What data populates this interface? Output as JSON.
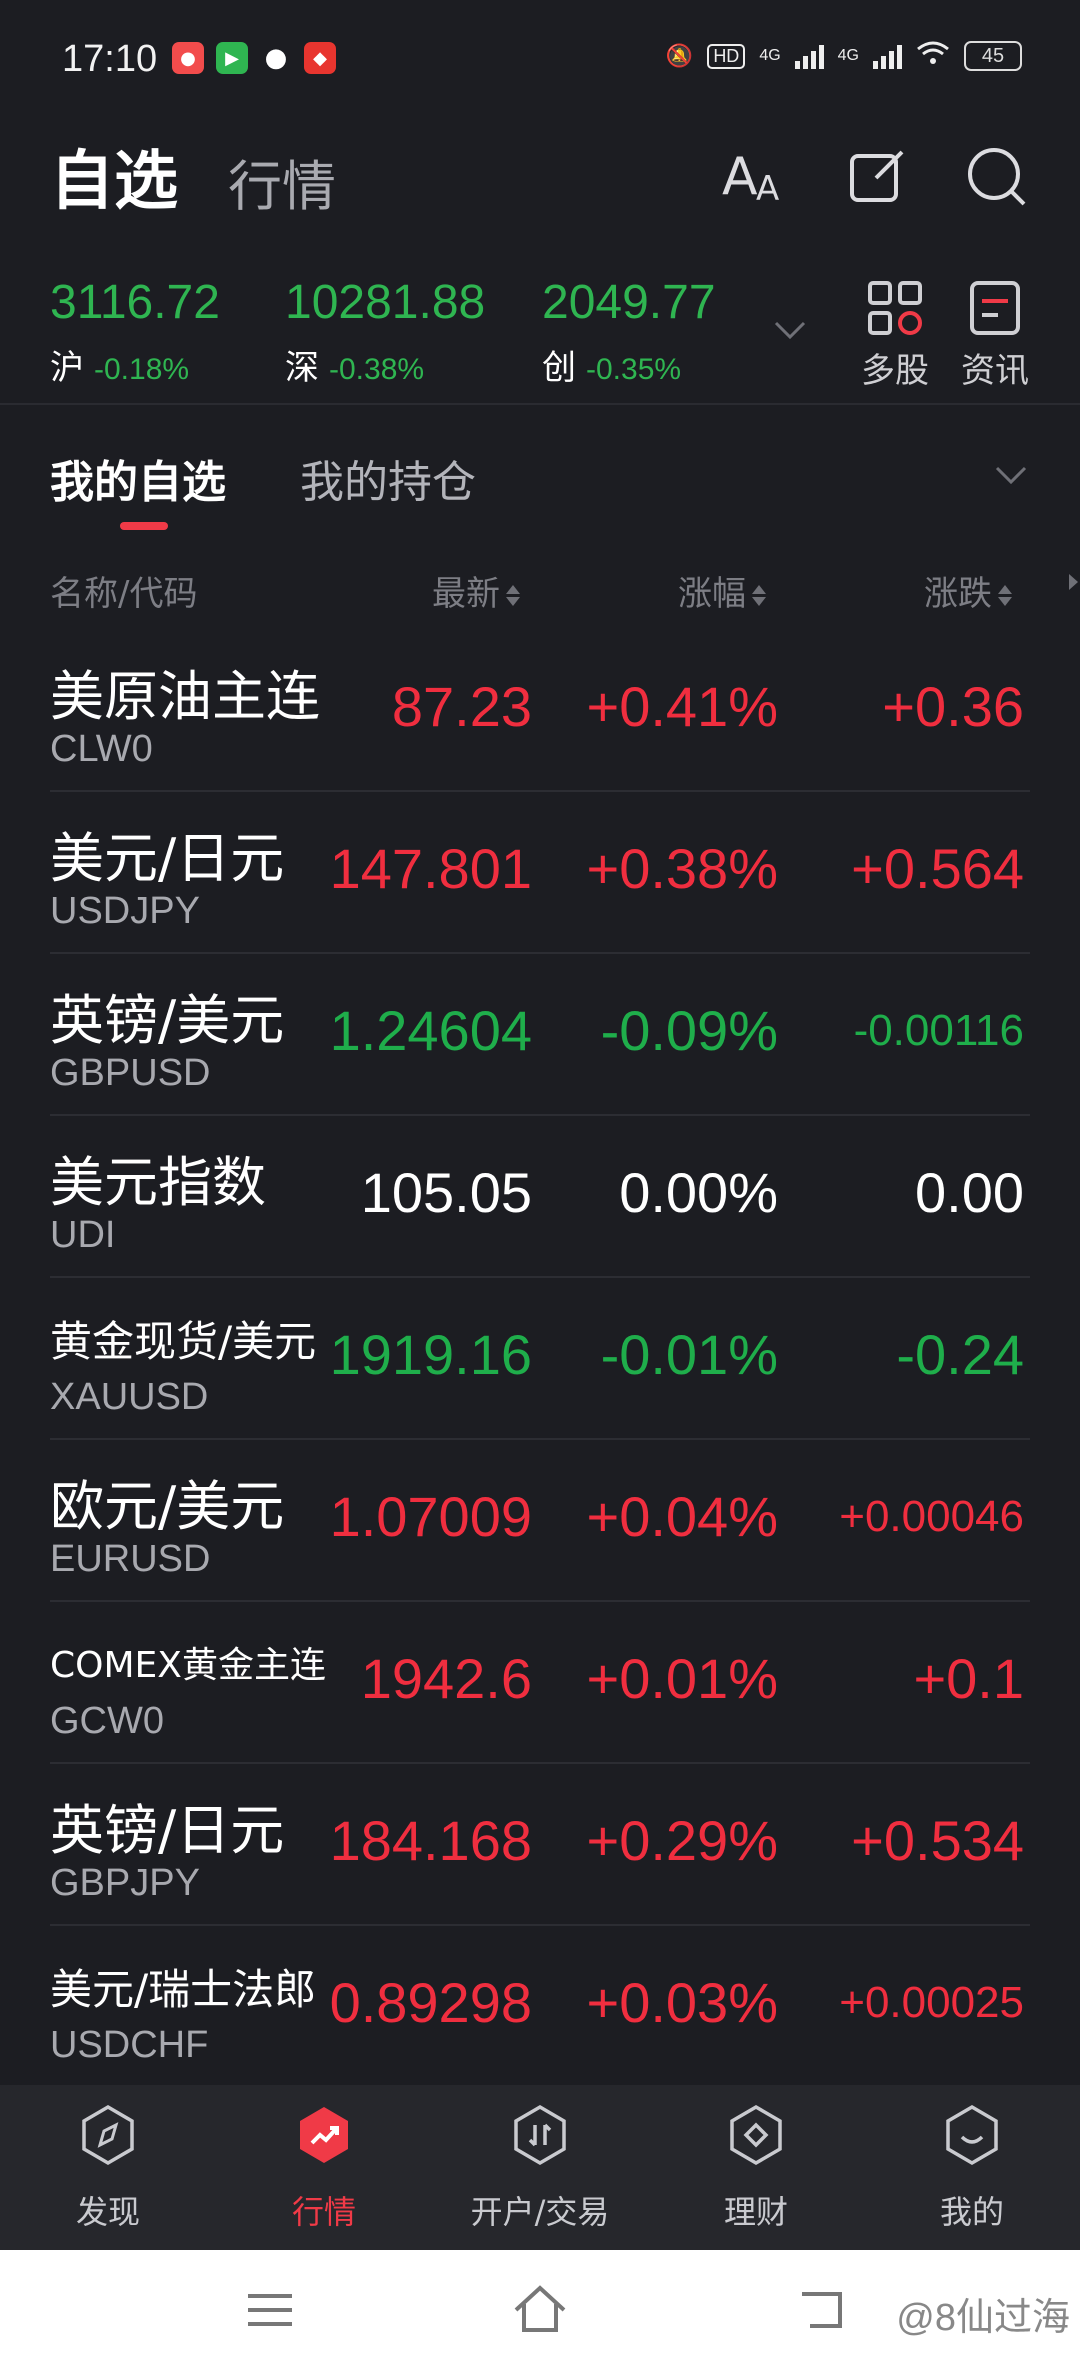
{
  "status_bar": {
    "time": "17:10",
    "network": "HD",
    "sig1": "4G",
    "sig2": "4G",
    "battery": "45"
  },
  "header": {
    "active_tab": "自选",
    "other_tab": "行情",
    "icons": [
      "font-size-icon",
      "edit-icon",
      "search-icon"
    ]
  },
  "indices": [
    {
      "value": "3116.72",
      "name": "沪",
      "change": "-0.18%"
    },
    {
      "value": "10281.88",
      "name": "深",
      "change": "-0.38%"
    },
    {
      "value": "2049.77",
      "name": "创",
      "change": "-0.35%"
    }
  ],
  "quick_buttons": {
    "multi": "多股",
    "news": "资讯"
  },
  "subtabs": {
    "active": "我的自选",
    "other": "我的持仓"
  },
  "columns": {
    "name": "名称/代码",
    "latest": "最新",
    "pct": "涨幅",
    "chg": "涨跌"
  },
  "rows": [
    {
      "name": "美原油主连",
      "code": "CLW0",
      "price": "87.23",
      "pct": "+0.41%",
      "chg": "+0.36",
      "dir": "up"
    },
    {
      "name": "美元/日元",
      "code": "USDJPY",
      "price": "147.801",
      "pct": "+0.38%",
      "chg": "+0.564",
      "dir": "up"
    },
    {
      "name": "英镑/美元",
      "code": "GBPUSD",
      "price": "1.24604",
      "pct": "-0.09%",
      "chg": "-0.00116",
      "dir": "down"
    },
    {
      "name": "美元指数",
      "code": "UDI",
      "price": "105.05",
      "pct": "0.00%",
      "chg": "0.00",
      "dir": "flat"
    },
    {
      "name": "黄金现货/美元",
      "code": "XAUUSD",
      "price": "1919.16",
      "pct": "-0.01%",
      "chg": "-0.24",
      "dir": "down"
    },
    {
      "name": "欧元/美元",
      "code": "EURUSD",
      "price": "1.07009",
      "pct": "+0.04%",
      "chg": "+0.00046",
      "dir": "up"
    },
    {
      "name": "COMEX黄金主连",
      "code": "GCW0",
      "price": "1942.6",
      "pct": "+0.01%",
      "chg": "+0.1",
      "dir": "up"
    },
    {
      "name": "英镑/日元",
      "code": "GBPJPY",
      "price": "184.168",
      "pct": "+0.29%",
      "chg": "+0.534",
      "dir": "up"
    },
    {
      "name": "美元/瑞士法郎",
      "code": "USDCHF",
      "price": "0.89298",
      "pct": "+0.03%",
      "chg": "+0.00025",
      "dir": "up"
    }
  ],
  "bottom_nav": [
    {
      "label": "发现",
      "icon": "compass-icon"
    },
    {
      "label": "行情",
      "icon": "trend-icon"
    },
    {
      "label": "开户/交易",
      "icon": "trade-icon"
    },
    {
      "label": "理财",
      "icon": "wealth-icon"
    },
    {
      "label": "我的",
      "icon": "profile-icon"
    }
  ],
  "watermark": "@8仙过海",
  "colors": {
    "up": "#f02e3f",
    "down": "#1fae4b",
    "accent": "#f03a47",
    "bg": "#1c1d22"
  }
}
